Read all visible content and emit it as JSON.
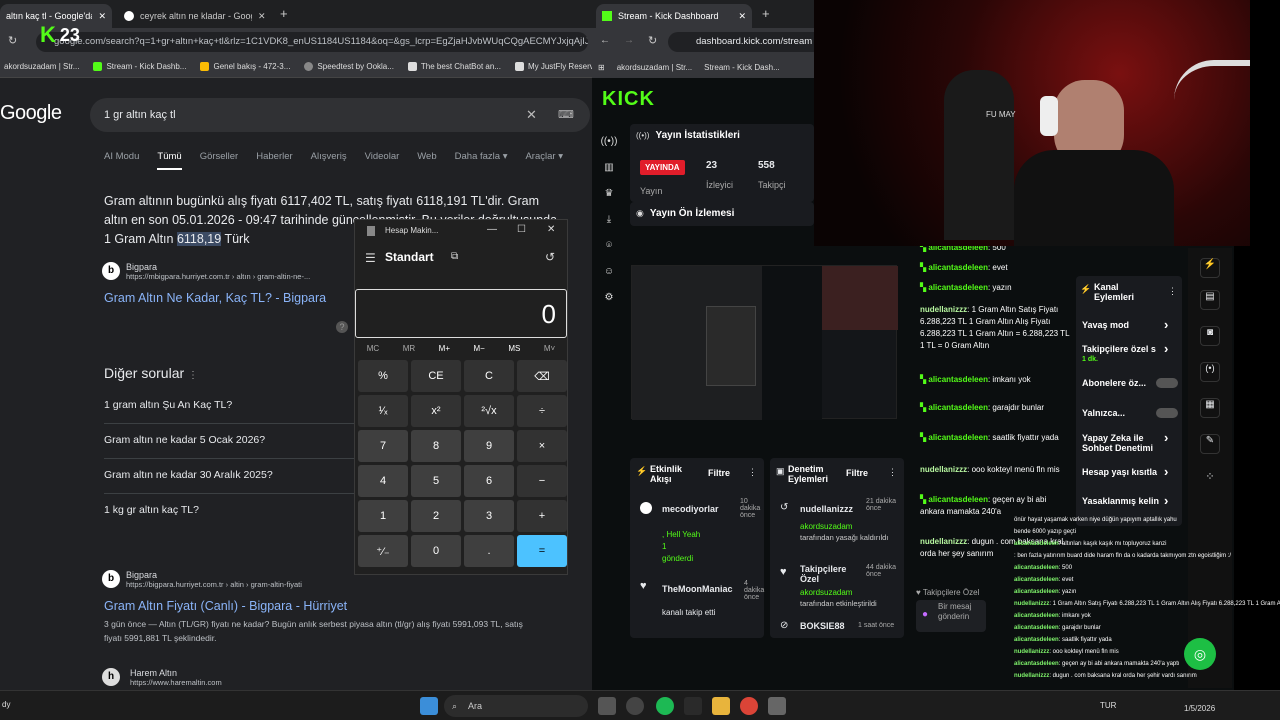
{
  "left_browser": {
    "tabs": [
      {
        "title": "altın kaç tl - Google'da Ara",
        "active": true
      },
      {
        "title": "ceyrek altın ne kladar - Google",
        "active": false
      }
    ],
    "url": "google.com/search?q=1+gr+altın+kaç+tl&rlz=1C1VDK8_enUS1184US1184&oq=&gs_lcrp=EgZjaHJvbWUqCQgAECMYJxjqAjIJCAA",
    "bookmarks": [
      "akordsuzadam | Str...",
      "Stream - Kick Dashb...",
      "Genel bakış - 472-3...",
      "Speedtest by Ookla...",
      "The best ChatBot an...",
      "My JustFly Reservati..."
    ]
  },
  "stream_overlay": {
    "viewer_count": "23"
  },
  "google": {
    "logo": "Google",
    "query": "1 gr altın kaç tl",
    "tabs": [
      "AI Modu",
      "Tümü",
      "Görseller",
      "Haberler",
      "Alışveriş",
      "Videolar",
      "Web",
      "Daha fazla ▾",
      "Araçlar ▾"
    ],
    "answer_part1": "Gram altının bugünkü alış fiyatı 6117,402 TL, satış fiyatı 6118,191 TL'dir. Gram altın en son 05.01.2026 - 09:47 tarihinde güncellenmiştir. Bu veriler doğrultusunda 1 Gram Altın ",
    "answer_highlight": "6118,19",
    "answer_part2": " Türk",
    "source1": {
      "name": "Bigpara",
      "url": "https://mbigpara.hurriyet.com.tr › altın › gram-altin-ne-...",
      "title": "Gram Altın Ne Kadar, Kaç TL? - Bigpara"
    },
    "other_questions_title": "Diğer sorular",
    "questions": [
      "1 gram altın Şu An Kaç TL?",
      "Gram altın ne kadar 5 Ocak 2026?",
      "Gram altın ne kadar 30 Aralık 2025?",
      "1 kg gr altın kaç TL?"
    ],
    "source2": {
      "name": "Bigpara",
      "url": "https://bigpara.hurriyet.com.tr › altin › gram-altin-fiyati",
      "title": "Gram Altın Fiyatı (Canlı) - Bigpara - Hürriyet"
    },
    "snippet": "3 gün önce — Altın (TL/GR) fiyatı ne kadar? Bugün anlık serbest piyasa altın (tl/gr) alış fiyatı 5991,093 TL, satış fiyatı 5991,881 TL şeklindedir.",
    "source3": {
      "name": "Harem Altın",
      "url": "https://www.haremaltin.com"
    }
  },
  "calculator": {
    "title": "Hesap Makin...",
    "mode": "Standart",
    "display": "0",
    "memory": [
      "MC",
      "MR",
      "M+",
      "M−",
      "MS",
      "M˅"
    ],
    "keys": [
      "%",
      "CE",
      "C",
      "⌫",
      "¹⁄ₓ",
      "x²",
      "²√x",
      "÷",
      "7",
      "8",
      "9",
      "×",
      "4",
      "5",
      "6",
      "−",
      "1",
      "2",
      "3",
      "+",
      "⁺⁄₋",
      "0",
      ".",
      "="
    ]
  },
  "right_browser": {
    "tab_title": "Stream - Kick Dashboard",
    "url": "dashboard.kick.com/stream",
    "bookmarks": [
      "akordsuzadam | Str...",
      "Stream - Kick Dash..."
    ]
  },
  "kick": {
    "logo": "KICK",
    "stats_title": "Yayın İstatistikleri",
    "live_badge": "YAYINDA",
    "live_label": "Yayın",
    "viewers_value": "23",
    "viewers_label": "İzleyici",
    "followers_value": "558",
    "followers_label": "Takipçi",
    "preview_title": "Yayın Ön İzlemesi",
    "activity_title": "Etkinlik Akışı",
    "filter": "Filtre",
    "activity": [
      {
        "user": "mecodiyorlar",
        "time": "10 dakika önce",
        "msg": ", Hell Yeah",
        "gift": "1",
        "gift_label": "gönderdi"
      },
      {
        "user": "TheMoonManiac",
        "time": "4 dakika önce",
        "msg": "kanalı takip etti"
      }
    ],
    "moderation_title": "Denetim Eylemleri",
    "moderation": [
      {
        "user": "nudellanizzz",
        "time": "21 dakika önce",
        "by": "akordsuzadam",
        "desc": "tarafından yasağı kaldırıldı"
      },
      {
        "user": "Takipçilere Özel",
        "time": "44 dakika önce",
        "by": "akordsuzadam",
        "desc": "tarafından etkinleştirildi"
      },
      {
        "user": "BOKSIE88",
        "time": "1 saat önce"
      }
    ],
    "chat": [
      {
        "user": "alicantasdeleen",
        "msg": ": 500"
      },
      {
        "user": "alicantasdeleen",
        "msg": ": evet"
      },
      {
        "user": "alicantasdeleen",
        "msg": ": yazın"
      },
      {
        "user": "nudellanizzz",
        "msg": ": 1 Gram Altın Satış Fiyatı 6.288,223 TL 1 Gram Altın Alış Fiyatı 6.288,223 TL 1 Gram Altın = 6.288,223 TL 1 TL = 0 Gram Altın"
      },
      {
        "user": "alicantasdeleen",
        "msg": ": imkanı yok"
      },
      {
        "user": "alicantasdeleen",
        "msg": ": garajdır bunlar"
      },
      {
        "user": "alicantasdeleen",
        "msg": ": saatlik fiyattır yada"
      },
      {
        "user": "nudellanizzz",
        "msg": ": ooo kokteyl menü fln mis"
      },
      {
        "user": "alicantasdeleen",
        "msg": ": geçen ay bi abi ankara mamakta 240'a"
      },
      {
        "user": "nudellanizzz",
        "msg": ": dugun . com baksana kral orda her şey sanırım"
      }
    ],
    "followers_only": "Takipçilere Özel",
    "send_placeholder": "Bir mesaj gönderin",
    "channel_actions_title": "Kanal Eylemleri",
    "channel_actions": [
      "Yavaş mod",
      "Takipçilere özel s",
      "Abonelere öz...",
      "Yalnızca...",
      "Yapay Zeka ile Sohbet Denetimi",
      "Hesap yaşı kısıtla",
      "Yasaklanmış kelin"
    ],
    "channel_sub": "1 dk."
  },
  "overlay_chat": [
    {
      "user": "",
      "msg": "önür hayat yaşamak varken niye düğün yapıyım aptallık yahu"
    },
    {
      "user": "",
      "msg": "bende 6000 yazıp geçti"
    },
    {
      "user": "alicantasdeleen",
      "msg": ": altınları kaşık kaşık mı topluyoruz kanzi"
    },
    {
      "user": "",
      "msg": ": ben fazla yatırırım buard dide haram fln da o kadarda takmıyom ztn egoistliğim :/"
    },
    {
      "user": "alicantasdeleen",
      "msg": ": 500"
    },
    {
      "user": "alicantasdeleen",
      "msg": ": evet"
    },
    {
      "user": "alicantasdeleen",
      "msg": ": yazın"
    },
    {
      "user": "nudellanizzz",
      "msg": ": 1 Gram Altın Satış Fiyatı 6.288,223 TL 1 Gram Altın Alış Fiyatı 6.288,223 TL 1 Gram Altın = 6.288,223 TL 1 TL = 0 Gram Altın"
    },
    {
      "user": "alicantasdeleen",
      "msg": ": imkanı yok"
    },
    {
      "user": "alicantasdeleen",
      "msg": ": garajdır bunlar"
    },
    {
      "user": "alicantasdeleen",
      "msg": ": saatlik fiyattır yada"
    },
    {
      "user": "nudellanizzz",
      "msg": ": ooo kokteyl menü fln mis"
    },
    {
      "user": "alicantasdeleen",
      "msg": ": geçen ay bi abi ankara mamakta 240'a yaptı"
    },
    {
      "user": "nudellanizzz",
      "msg": ": dugun . com baksana kral orda her şehir vardı sanırım"
    }
  ],
  "webcam": {
    "headset_brand": "FU MAY"
  },
  "taskbar": {
    "search": "Ara",
    "left_text": "dy",
    "lang": "TUR",
    "date": "1/5/2026"
  }
}
